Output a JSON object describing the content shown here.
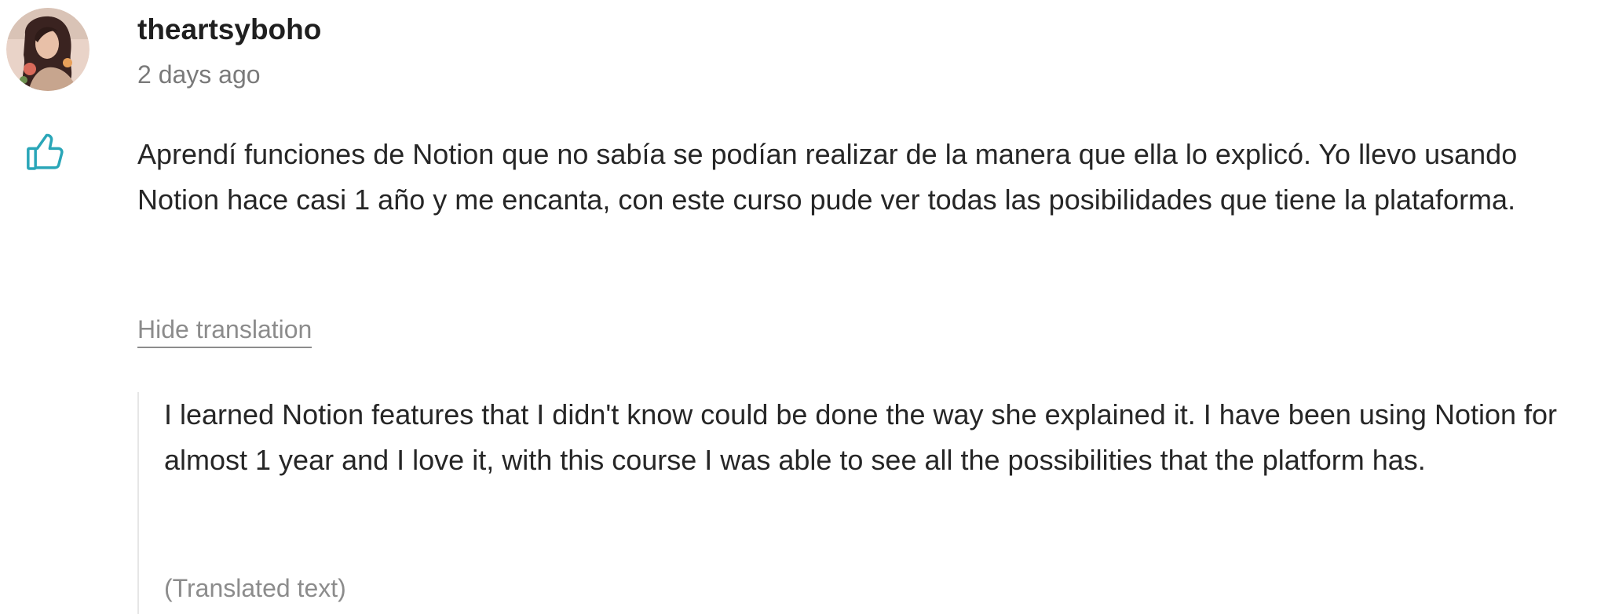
{
  "review": {
    "author": {
      "username": "theartsyboho",
      "avatar_icon": "user-avatar-photo"
    },
    "timestamp": "2 days ago",
    "like_icon": "thumbs-up-icon",
    "original_text": "Aprendí funciones de Notion que no sabía se podían realizar de la manera que ella lo explicó. Yo llevo usando Notion hace casi 1 año y me encanta, con este curso pude ver todas las posibilidades que tiene la plataforma.",
    "hide_translation_label": "Hide translation",
    "translated_text": "I learned Notion features that I didn't know could be done the way she explained it. I have been using Notion for almost 1 year and I love it, with this course I was able to see all the possibilities that the platform has.",
    "translated_note": "(Translated text)"
  },
  "colors": {
    "accent_like": "#2aa6b8",
    "text_primary": "#262626",
    "text_muted": "#8c8c8c",
    "divider": "#e6e6e6"
  }
}
